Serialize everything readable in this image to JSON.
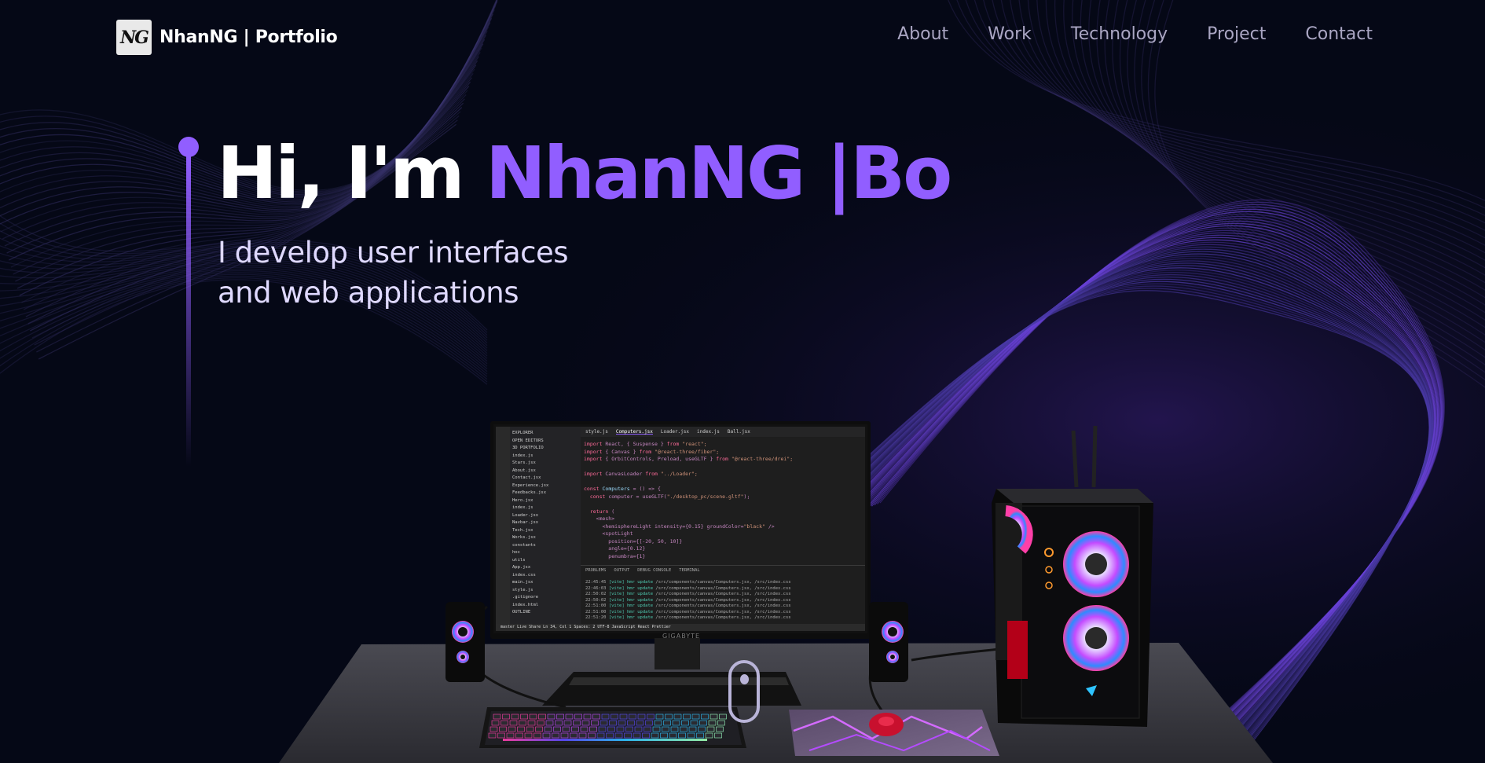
{
  "navbar": {
    "logo_text": "NG",
    "brand": "NhanNG | Portfolio",
    "links": [
      {
        "label": "About"
      },
      {
        "label": "Work"
      },
      {
        "label": "Technology"
      },
      {
        "label": "Project"
      },
      {
        "label": "Contact"
      }
    ]
  },
  "hero": {
    "greeting": "Hi, I'm ",
    "name": "NhanNG |Bo",
    "subtitle_line1": "I develop user interfaces",
    "subtitle_line2": "and web applications"
  },
  "monitor": {
    "brand": "GIGABYTE",
    "tabs": [
      "style.js",
      "Computers.jsx",
      "Loader.jsx",
      "index.js",
      "Ball.jsx"
    ],
    "files": [
      "EXPLORER",
      "OPEN EDITORS",
      "3D PORTFOLIO",
      "index.js",
      "Stars.jsx",
      "About.jsx",
      "Contact.jsx",
      "Experience.jsx",
      "Feedbacks.jsx",
      "Hero.jsx",
      "index.js",
      "Loader.jsx",
      "Navbar.jsx",
      "Tech.jsx",
      "Works.jsx",
      "constants",
      "hoc",
      "utils",
      "App.jsx",
      "index.css",
      "main.jsx",
      "style.js",
      ".gitignore",
      "index.html",
      "OUTLINE"
    ],
    "status": "master   Live Share   Ln 34, Col 1   Spaces: 2   UTF-8   JavaScript React   Prettier"
  },
  "colors": {
    "background": "#050816",
    "accent": "#915eff",
    "nav_text": "#aaa6c3",
    "subtitle": "#dfd9ff"
  }
}
